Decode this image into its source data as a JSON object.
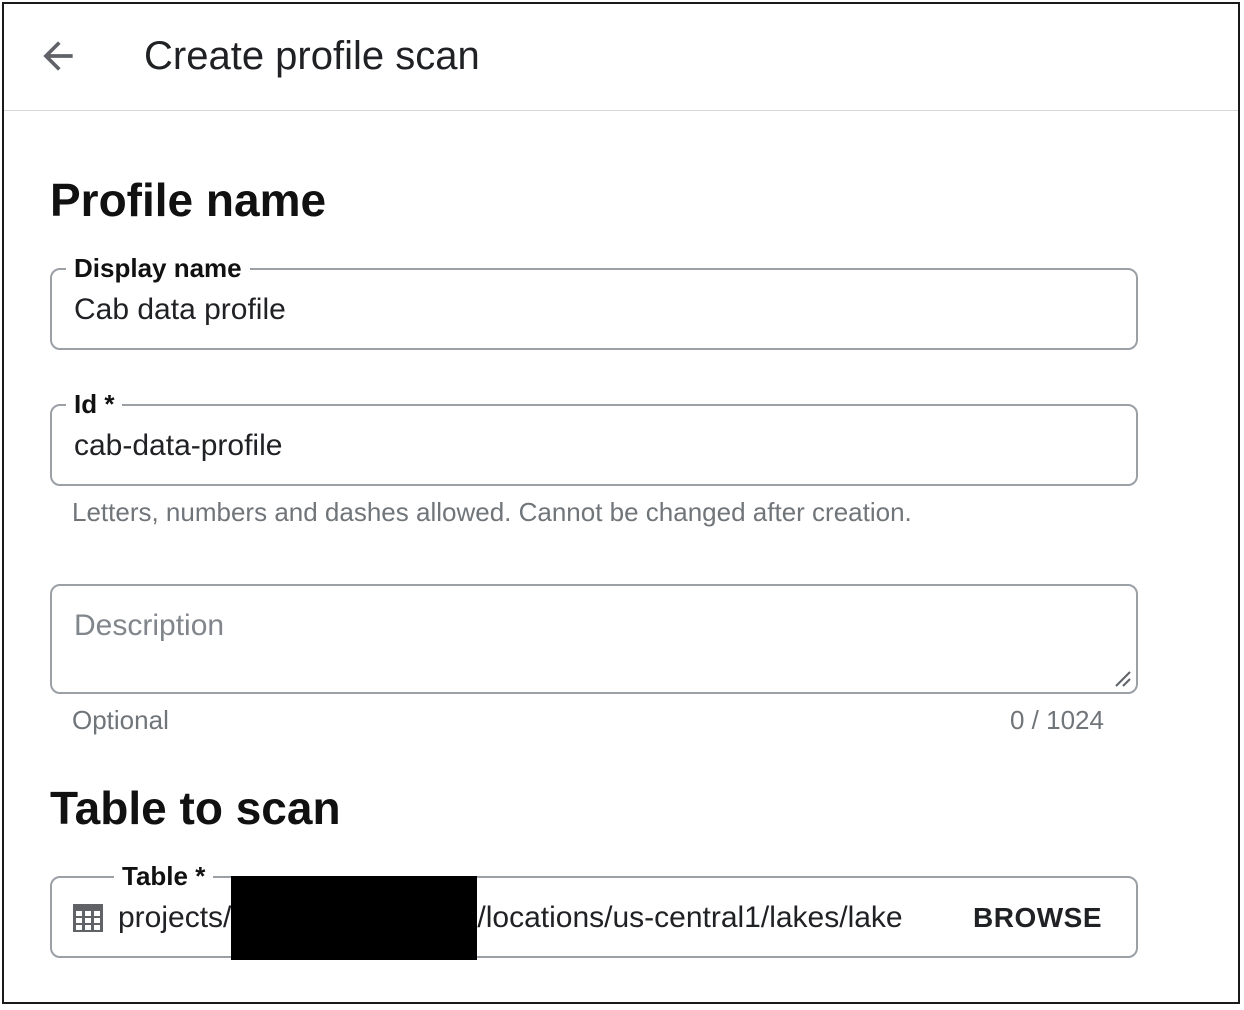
{
  "header": {
    "title": "Create profile scan",
    "back_icon": "arrow-back-icon"
  },
  "profile_section": {
    "title": "Profile name",
    "display_name": {
      "label": "Display name",
      "value": "Cab data profile"
    },
    "id": {
      "label": "Id *",
      "value": "cab-data-profile",
      "hint": "Letters, numbers and dashes allowed. Cannot be changed after creation."
    },
    "description": {
      "placeholder": "Description",
      "value": "",
      "helper": "Optional",
      "counter": "0 / 1024"
    }
  },
  "table_section": {
    "title": "Table to scan",
    "table": {
      "label": "Table *",
      "icon": "table-grid-icon",
      "path_prefix": "projects/",
      "path_suffix": "/locations/us-central1/lakes/lake",
      "browse_label": "BROWSE"
    }
  },
  "colors": {
    "border": "#9aa0a6",
    "text": "#202124",
    "hint": "#70757a",
    "icon": "#5f6368"
  }
}
